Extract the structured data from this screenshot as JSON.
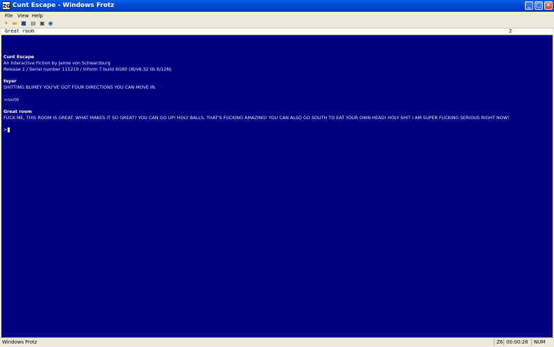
{
  "window": {
    "title": "Cunt Escape - Windows Frotz",
    "app_icon_text": "ZG",
    "minimize": "_",
    "maximize": "□",
    "close": "✕"
  },
  "menu": {
    "items": [
      "File",
      "View",
      "Help"
    ]
  },
  "toolbar": {
    "icons": [
      "new-icon",
      "open-icon",
      "save-icon",
      "copy-icon",
      "print-icon",
      "help-icon"
    ]
  },
  "status_line": {
    "location": "Great room",
    "score": "2"
  },
  "game": {
    "title": "Cunt Escape",
    "byline": "An Interactive Fiction by Jaime von Schwarzburg",
    "release": "Release 1 / Serial number 111219 / Inform 7 build 6G60 (I6/v6.32 lib 6/12N)",
    "room1_name": "foyer",
    "room1_desc": "SHITTING BLIMEY YOU'VE GOT FOUR DIRECTIONS YOU CAN MOVE IN.",
    "command1": ">north",
    "room2_name": "Great room",
    "room2_desc": "FUCK ME, THIS ROOM IS GREAT. WHAT MAKES IT SO GREAT? YOU CAN GO UP! HOLY BALLS, THAT'S FUCKING AMAZING! YOU CAN ALSO GO SOUTH TO EAT YOUR OWN HEAD! HOLY SHIT I AM SUPER FUCKING SERIOUS RIGHT NOW!",
    "prompt": ">"
  },
  "statusbar": {
    "text": "Windows Frotz",
    "version": "Z6",
    "time": "00:00:28",
    "num": "NUM"
  }
}
